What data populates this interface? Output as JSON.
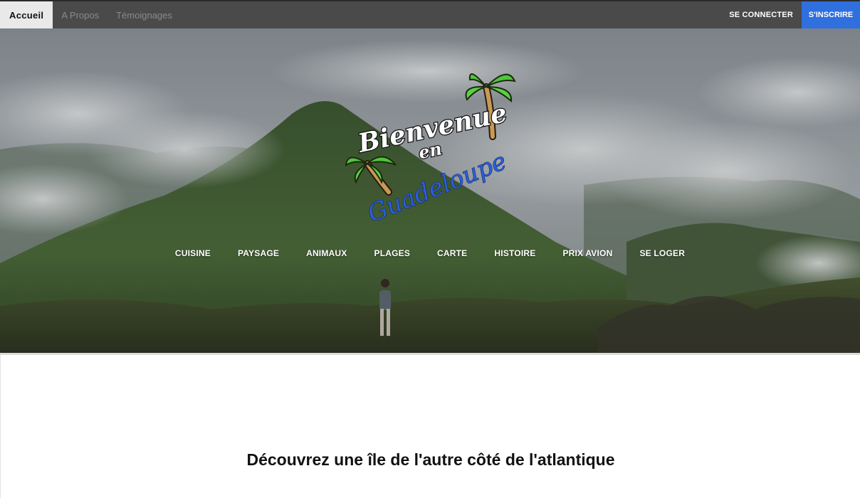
{
  "topbar": {
    "nav": [
      {
        "label": "Accueil",
        "active": true
      },
      {
        "label": "A Propos",
        "active": false
      },
      {
        "label": "Témoignages",
        "active": false
      }
    ],
    "login_label": "SE CONNECTER",
    "signup_label": "S'INSCRIRE"
  },
  "logo": {
    "line1": "Bienvenue",
    "line2": "en",
    "line3": "Guadeloupe",
    "icon": "palm-tree-icon"
  },
  "categories": [
    {
      "label": "CUISINE"
    },
    {
      "label": "PAYSAGE"
    },
    {
      "label": "ANIMAUX"
    },
    {
      "label": "PLAGES"
    },
    {
      "label": "CARTE"
    },
    {
      "label": "HISTOIRE"
    },
    {
      "label": "PRIX AVION"
    },
    {
      "label": "SE LOGER"
    }
  ],
  "content": {
    "headline": "Découvrez une île de l'autre côté de l'atlantique"
  },
  "colors": {
    "topbar_bg": "#4a4a4a",
    "active_tab_bg": "#e9e9e9",
    "signup_bg": "#2f6fde",
    "logo_blue": "#2a5fd6"
  }
}
